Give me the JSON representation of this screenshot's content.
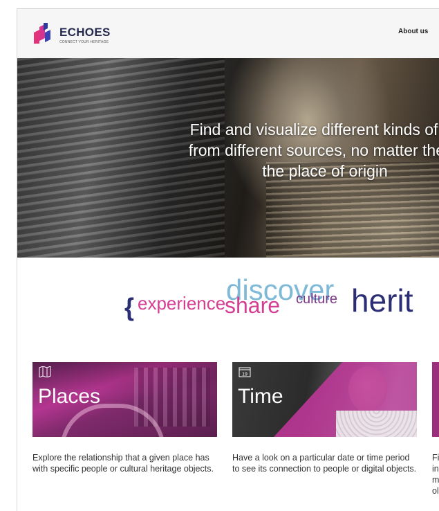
{
  "header": {
    "logo_name": "ECHOES",
    "logo_tagline": "CONNECT YOUR HERITAGE",
    "nav_about": "About us"
  },
  "hero": {
    "line1": "Find and visualize different kinds of he",
    "line2": "from different sources, no matter the la",
    "line3": "the place of origin"
  },
  "word_cloud": {
    "brace": "{",
    "experience": "experience",
    "discover": "discover",
    "share": "share",
    "culture": "culture",
    "heritage": "herit"
  },
  "cards": [
    {
      "title": "Places",
      "icon": "map-icon",
      "description": "Explore the relationship that a given place has with specific people or cultural heritage objects."
    },
    {
      "title": "Time",
      "icon": "calendar-icon",
      "calendar_day": "19",
      "description": "Have a look on a particular date or time period to see its connection to people or digital objects."
    },
    {
      "title": "",
      "description_fragments": [
        "Fi",
        "in",
        "m",
        "ol"
      ]
    }
  ],
  "colors": {
    "brand_navy": "#262a4e",
    "magenta": "#d53e93",
    "light_blue": "#7fb9d8",
    "purple": "#7a3a86"
  }
}
